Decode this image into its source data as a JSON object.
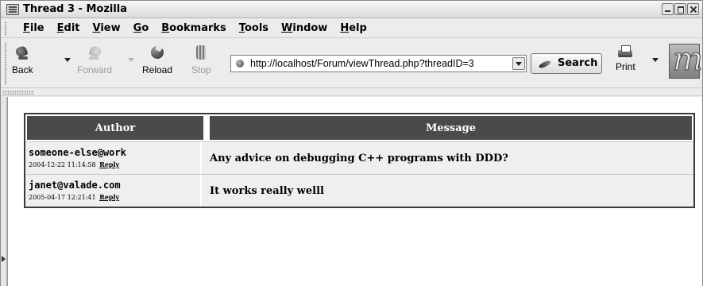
{
  "window": {
    "title": "Thread 3 - Mozilla"
  },
  "menubar": {
    "items": [
      "File",
      "Edit",
      "View",
      "Go",
      "Bookmarks",
      "Tools",
      "Window",
      "Help"
    ]
  },
  "toolbar": {
    "back_label": "Back",
    "forward_label": "Forward",
    "reload_label": "Reload",
    "stop_label": "Stop",
    "print_label": "Print",
    "search_label": "Search",
    "url": "http://localhost/Forum/viewThread.php?threadID=3"
  },
  "thread": {
    "headers": {
      "author": "Author",
      "message": "Message"
    },
    "posts": [
      {
        "author": "someone-else@work",
        "timestamp": "2004-12-22 11:14:58",
        "reply_label": "Reply",
        "message": "Any advice on debugging C++ programs with DDD?"
      },
      {
        "author": "janet@valade.com",
        "timestamp": "2005-04-17 12:21:41",
        "reply_label": "Reply",
        "message": "It works really welll"
      }
    ]
  }
}
